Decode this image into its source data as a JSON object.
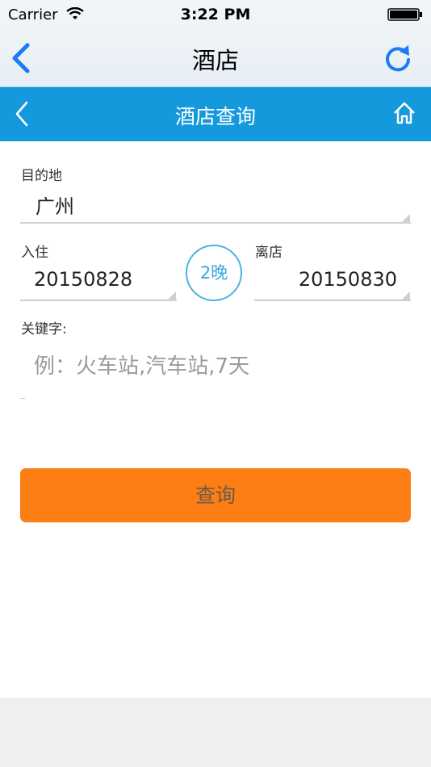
{
  "status_bar": {
    "carrier": "Carrier",
    "time": "3:22 PM"
  },
  "nav_bar": {
    "title": "酒店"
  },
  "header": {
    "title": "酒店查询"
  },
  "form": {
    "destination_label": "目的地",
    "destination_value": "广州",
    "checkin_label": "入住",
    "checkin_value": "20150828",
    "nights_badge": "2晚",
    "checkout_label": "离店",
    "checkout_value": "20150830",
    "keyword_label": "关键字:",
    "keyword_placeholder": "例：火车站,汽车站,7天",
    "keyword_value": ""
  },
  "search_button_label": "查询",
  "colors": {
    "header_blue": "#1499dc",
    "ios_blue": "#1a7cf5",
    "search_orange": "#fd7e14",
    "badge_blue": "#4bb3e0"
  }
}
